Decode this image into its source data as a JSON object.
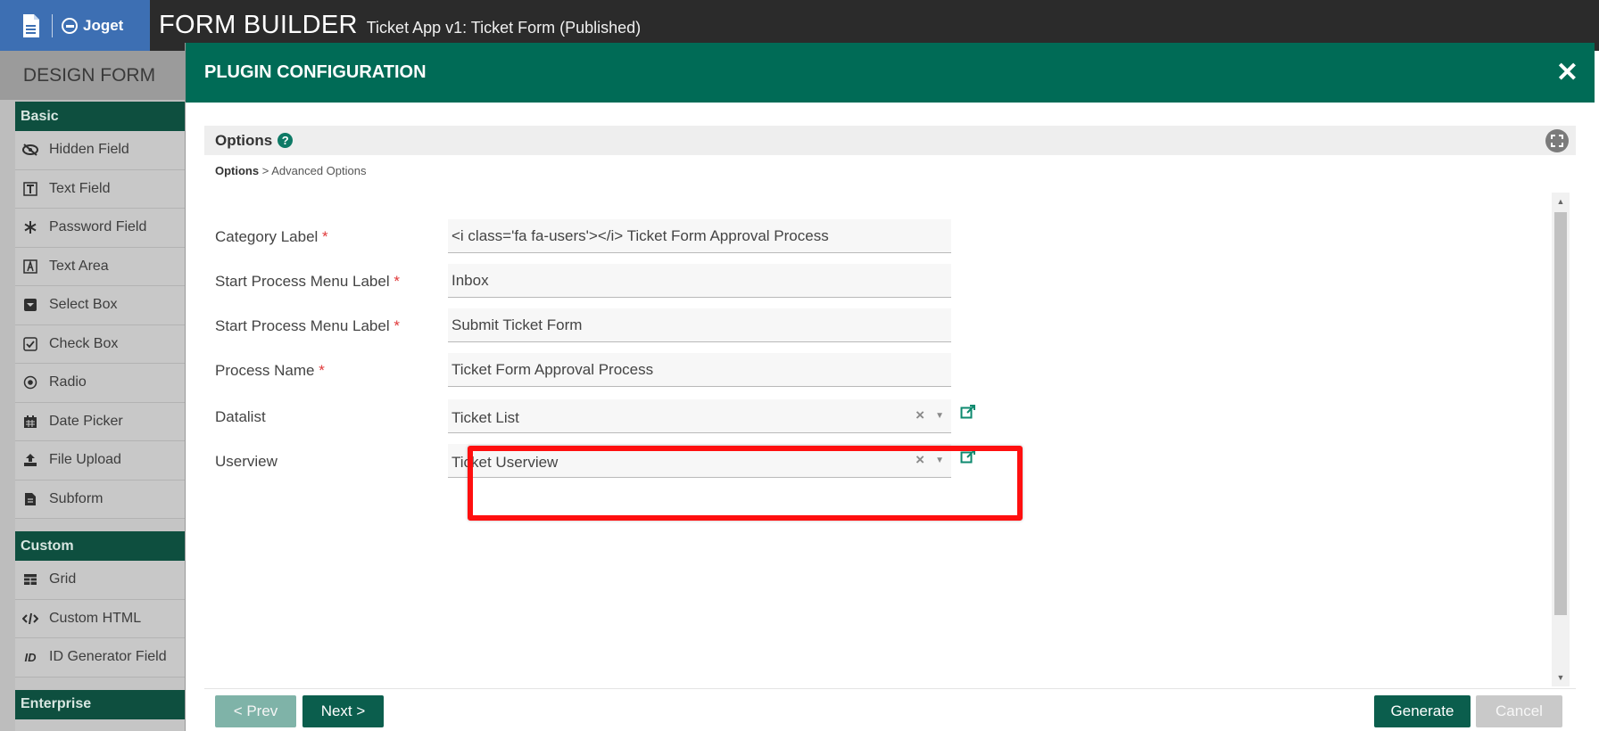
{
  "header": {
    "brand": "Joget",
    "title": "FORM BUILDER",
    "subtitle": "Ticket App v1: Ticket Form (Published)"
  },
  "sidebar": {
    "design_tab": "DESIGN FORM",
    "categories": [
      {
        "label": "Basic",
        "items": [
          {
            "label": "Hidden Field",
            "icon": "eye-slash-icon"
          },
          {
            "label": "Text Field",
            "icon": "text-field-icon"
          },
          {
            "label": "Password Field",
            "icon": "asterisk-icon"
          },
          {
            "label": "Text Area",
            "icon": "text-area-icon"
          },
          {
            "label": "Select Box",
            "icon": "select-box-icon"
          },
          {
            "label": "Check Box",
            "icon": "check-box-icon"
          },
          {
            "label": "Radio",
            "icon": "radio-icon"
          },
          {
            "label": "Date Picker",
            "icon": "calendar-icon"
          },
          {
            "label": "File Upload",
            "icon": "upload-icon"
          },
          {
            "label": "Subform",
            "icon": "subform-icon"
          }
        ]
      },
      {
        "label": "Custom",
        "items": [
          {
            "label": "Grid",
            "icon": "grid-icon"
          },
          {
            "label": "Custom HTML",
            "icon": "code-icon"
          },
          {
            "label": "ID Generator Field",
            "icon": "id-icon"
          }
        ]
      },
      {
        "label": "Enterprise",
        "items": []
      }
    ]
  },
  "modal": {
    "title": "PLUGIN CONFIGURATION",
    "close_label": "✕",
    "section_title": "Options",
    "breadcrumb": {
      "current": "Options",
      "separator": ">",
      "next": "Advanced Options"
    },
    "fields": [
      {
        "label": "Category Label",
        "required": "*",
        "value": "<i class='fa fa-users'></i> Ticket Form Approval Process",
        "type": "text"
      },
      {
        "label": "Start Process Menu Label",
        "required": "*",
        "value": "Inbox",
        "type": "text"
      },
      {
        "label": "Start Process Menu Label",
        "required": "*",
        "value": "Submit Ticket Form",
        "type": "text"
      },
      {
        "label": "Process Name",
        "required": "*",
        "value": "Ticket Form Approval Process",
        "type": "text"
      },
      {
        "label": "Datalist",
        "required": "",
        "value": "Ticket List",
        "type": "select"
      },
      {
        "label": "Userview",
        "required": "",
        "value": "Ticket Userview",
        "type": "select"
      }
    ],
    "buttons": {
      "prev": "< Prev",
      "next": "Next >",
      "generate": "Generate",
      "cancel": "Cancel"
    }
  },
  "colors": {
    "header_green": "#006b56",
    "button_green": "#0b5e4d",
    "highlight_red": "#ff0f0f",
    "required_red": "#e0393a"
  }
}
